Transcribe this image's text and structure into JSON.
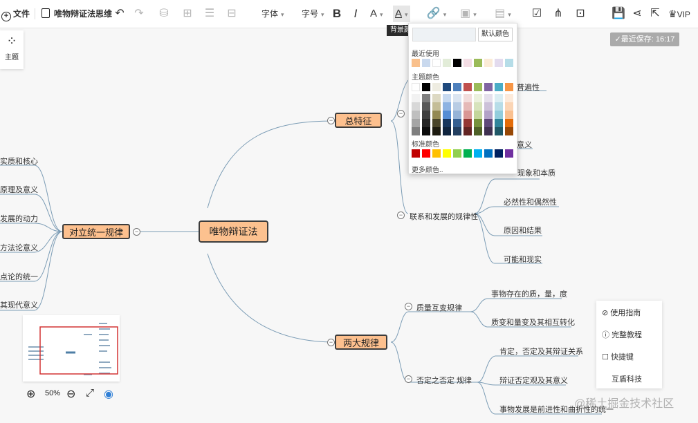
{
  "toolbar": {
    "file_label": "文件",
    "doc_title": "唯物辩证法思维",
    "font_label": "字体",
    "fontsize_label": "字号",
    "bold_glyph": "B",
    "italic_glyph": "I",
    "fontcolor_glyph": "A",
    "bgcolor_glyph": "A",
    "vip_label": "VIP"
  },
  "tooltip": {
    "text": "背景颜色"
  },
  "theme_panel": {
    "label": "主题"
  },
  "autosave": {
    "text": "最近保存: 16:17"
  },
  "color_picker": {
    "default_button": "默认颜色",
    "recent_label": "最近使用",
    "theme_label": "主题颜色",
    "standard_label": "标准颜色",
    "more_label": "更多颜色..",
    "recent_colors": [
      "#f9c08c",
      "#c9d9ee",
      "#ffffff",
      "#e2ecd8",
      "#000000",
      "#f3dde4",
      "#9bbb59",
      "#fbebd7",
      "#e3dbee",
      "#b6dde8"
    ],
    "theme_colors": [
      [
        "#ffffff",
        "#000000",
        "#eeece1",
        "#1f497d",
        "#4f81bd",
        "#c0504d",
        "#9bbb59",
        "#8064a2",
        "#4bacc6",
        "#f79646"
      ],
      [
        "#f2f2f2",
        "#7f7f7f",
        "#ddd9c3",
        "#c6d9f0",
        "#dbe5f1",
        "#f2dcdb",
        "#ebf1dd",
        "#e5e0ec",
        "#dbeef3",
        "#fdeada"
      ],
      [
        "#d8d8d8",
        "#595959",
        "#c4bd97",
        "#8db3e2",
        "#b8cce4",
        "#e5b9b7",
        "#d7e3bc",
        "#ccc1d9",
        "#b7dde8",
        "#fbd5b5"
      ],
      [
        "#bfbfbf",
        "#3f3f3f",
        "#938953",
        "#548dd4",
        "#95b3d7",
        "#d99694",
        "#c3d69b",
        "#b2a2c7",
        "#92cddc",
        "#fac08f"
      ],
      [
        "#a5a5a5",
        "#262626",
        "#494429",
        "#17365d",
        "#366092",
        "#953734",
        "#76923c",
        "#5f497a",
        "#31859b",
        "#e36c09"
      ],
      [
        "#7f7f7f",
        "#0c0c0c",
        "#1d1b10",
        "#0f243e",
        "#244061",
        "#632423",
        "#4f6128",
        "#3f3151",
        "#205867",
        "#974806"
      ]
    ],
    "standard_colors": [
      "#c00000",
      "#ff0000",
      "#ffc000",
      "#ffff00",
      "#92d050",
      "#00b050",
      "#00b0f0",
      "#0070c0",
      "#002060",
      "#7030a0"
    ]
  },
  "mindmap": {
    "root": "唯物辩证法",
    "branch_total": "总特征",
    "branch_unity": "对立统一规律",
    "branch_two": "两大规律",
    "total_partial": [
      "普遍性",
      "意义"
    ],
    "sub_relation": "联系和发展的规律性",
    "relation_leaves": [
      "现象和本质",
      "必然性和偶然性",
      "原因和结果",
      "可能和现实"
    ],
    "unity_leaves": [
      "实质和核心",
      "原理及意义",
      "发展的动力",
      "方法论意义",
      "点论的统一",
      "其现代意义"
    ],
    "sub_quality": "质量互变规律",
    "quality_leaves": [
      "事物存在的质，量，度",
      "质变和量变及其相互转化"
    ],
    "sub_negation": "否定之否定 规律",
    "negation_leaves": [
      "肯定，否定及其辩证关系",
      "辩证否定观及其意义",
      "事物发展是前进性和曲折性的统一"
    ]
  },
  "zoom": {
    "level": "50%"
  },
  "help": {
    "guide": "使用指南",
    "tutorial": "完整教程",
    "shortcuts": "快捷键",
    "brand": "互盾科技"
  },
  "watermark": "@稀土掘金技术社区"
}
